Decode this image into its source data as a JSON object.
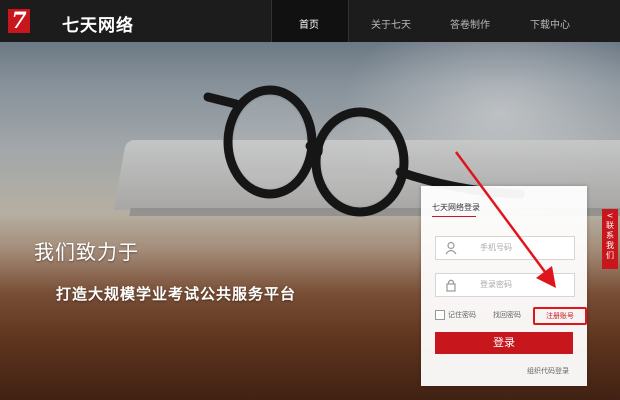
{
  "header": {
    "logo_mark": "7",
    "brand": "七天网络",
    "nav": [
      {
        "label": "首页"
      },
      {
        "label": "关于七天"
      },
      {
        "label": "答卷制作"
      },
      {
        "label": "下载中心"
      }
    ],
    "active_index": 0
  },
  "hero": {
    "slogan_line1": "我们致力于",
    "slogan_line2": "打造大规模学业考试公共服务平台"
  },
  "login": {
    "title": "七天网络登录",
    "phone_placeholder": "手机号码",
    "password_placeholder": "登录密码",
    "remember_label": "记住密码",
    "forgot_label": "找回密码",
    "register_label": "注册账号",
    "login_button": "登录",
    "org_code_login": "组织代码登录"
  },
  "side_tab": {
    "label": "联系我们",
    "arrow": "<"
  },
  "icons": {
    "user": "user-icon",
    "lock": "lock-icon"
  },
  "colors": {
    "brand_red": "#c8161d",
    "nav_bg": "#1c1c1c",
    "annotation_red": "#e0141c"
  }
}
